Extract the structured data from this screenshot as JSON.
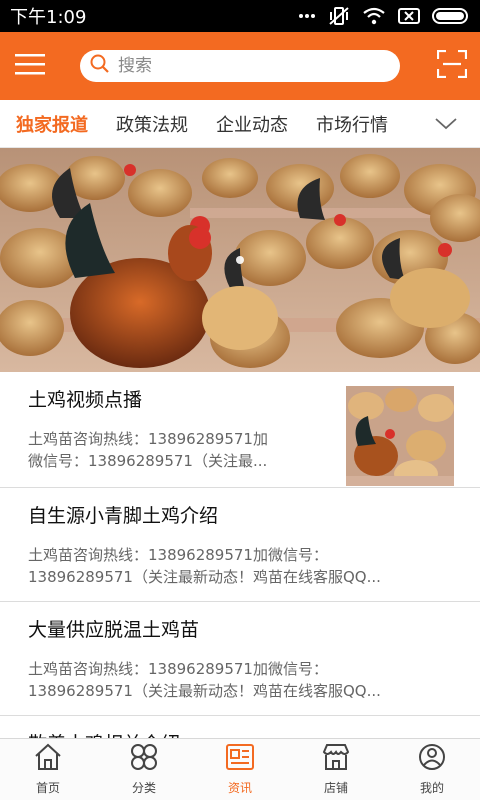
{
  "status_bar": {
    "time": "下午1:09",
    "icons": [
      "more-dots-icon",
      "vibrate-icon",
      "wifi-icon",
      "sim-icon",
      "battery-icon"
    ]
  },
  "header": {
    "menu_icon": "menu-icon",
    "search": {
      "placeholder": "搜索",
      "value": ""
    },
    "scan_icon": "scan-icon",
    "accent_color": "#f36a21"
  },
  "tabs": {
    "items": [
      {
        "label": "独家报道",
        "active": true
      },
      {
        "label": "政策法规",
        "active": false
      },
      {
        "label": "企业动态",
        "active": false
      },
      {
        "label": "市场行情",
        "active": false
      }
    ],
    "more_icon": "chevron-down-icon"
  },
  "banner": {
    "slides": 2,
    "current": 1
  },
  "articles": [
    {
      "title": "土鸡视频点播",
      "summary_line1": "土鸡苗咨询热线：13896289571加",
      "summary_line2": "微信号：13896289571（关注最...",
      "has_thumb": true
    },
    {
      "title": "自生源小青脚土鸡介绍",
      "summary_line1": "土鸡苗咨询热线：13896289571加微信号：",
      "summary_line2": "13896289571（关注最新动态！鸡苗在线客服QQ...",
      "has_thumb": false
    },
    {
      "title": "大量供应脱温土鸡苗",
      "summary_line1": "土鸡苗咨询热线：13896289571加微信号：",
      "summary_line2": "13896289571（关注最新动态！鸡苗在线客服QQ...",
      "has_thumb": false
    },
    {
      "title": "散养土鸡相关介绍",
      "summary_line1": "",
      "summary_line2": "",
      "has_thumb": false
    }
  ],
  "bottom_nav": {
    "items": [
      {
        "label": "首页",
        "icon": "home-icon",
        "active": false
      },
      {
        "label": "分类",
        "icon": "category-icon",
        "active": false
      },
      {
        "label": "资讯",
        "icon": "news-icon",
        "active": true
      },
      {
        "label": "店铺",
        "icon": "store-icon",
        "active": false
      },
      {
        "label": "我的",
        "icon": "user-icon",
        "active": false
      }
    ]
  }
}
